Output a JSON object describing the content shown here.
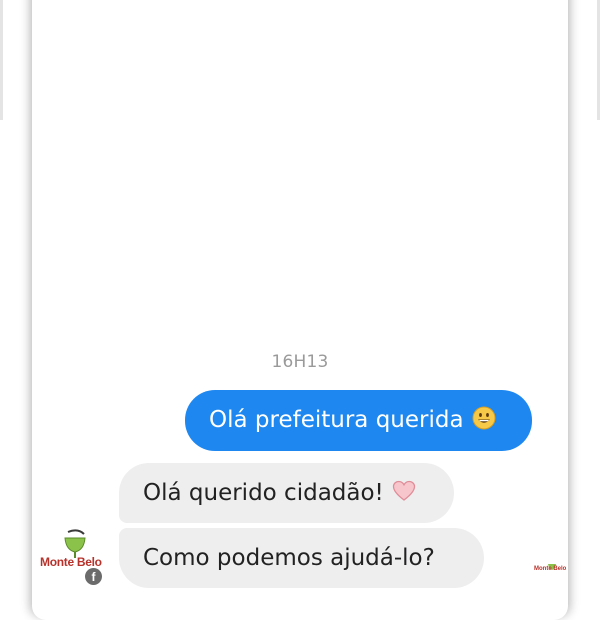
{
  "chat": {
    "timestamp": "16H13",
    "messages": [
      {
        "sender": "user",
        "text": "Olá prefeitura querida",
        "emoji": "grinning-face-emoji"
      },
      {
        "sender": "page",
        "text": "Olá querido cidadão!",
        "emoji": "pink-heart-emoji"
      },
      {
        "sender": "page",
        "text": "Como podemos ajudá-lo?"
      }
    ]
  },
  "avatar": {
    "brand": "Monte Belo",
    "badge": "f"
  },
  "read_receipt": {
    "brand": "Monte Belo"
  },
  "colors": {
    "outgoing_bubble": "#1e88f0",
    "incoming_bubble": "#eeeeef",
    "brand_red": "#b7322b",
    "timestamp": "#9a9a9a"
  }
}
